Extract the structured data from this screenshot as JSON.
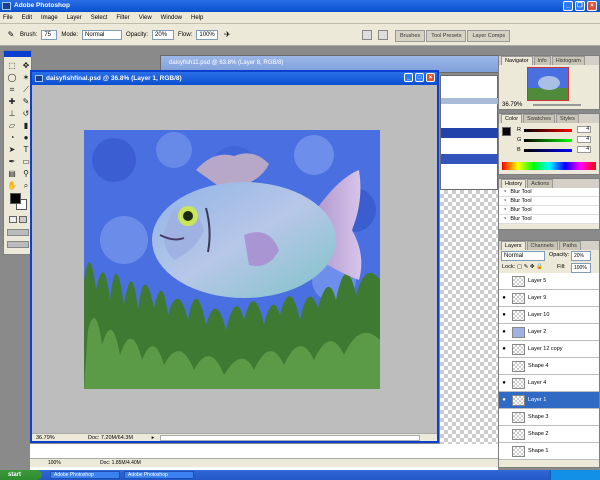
{
  "app": {
    "title": "Adobe Photoshop"
  },
  "menu": [
    "File",
    "Edit",
    "Image",
    "Layer",
    "Select",
    "Filter",
    "View",
    "Window",
    "Help"
  ],
  "options": {
    "brush_label": "Brush:",
    "brush_size": "75",
    "mode_label": "Mode:",
    "mode_value": "Normal",
    "opacity_label": "Opacity:",
    "opacity_value": "20%",
    "flow_label": "Flow:",
    "flow_value": "100%"
  },
  "palette_well": [
    "Brushes",
    "Tool Presets",
    "Layer Comps"
  ],
  "document": {
    "title": "daisyfishfinal.psd @ 36.8% (Layer 1, RGB/8)",
    "zoom": "36.79%",
    "doc_info": "Doc: 7.20M/64.3M"
  },
  "bg_document": {
    "title": "daisyfish11.psd @ 63.8% (Layer 8, RGB/8)",
    "zoom": "100%",
    "doc_info": "Doc: 1.85M/4.40M"
  },
  "navigator": {
    "tabs": [
      "Navigator",
      "Info",
      "Histogram"
    ],
    "zoom": "36.79%"
  },
  "color_panel": {
    "tabs": [
      "Color",
      "Swatches",
      "Styles"
    ],
    "r": "4",
    "g": "4",
    "b": "4",
    "colors": {
      "fg": "#050505",
      "bg": "#ffffff"
    }
  },
  "history": {
    "tabs": [
      "History",
      "Actions"
    ],
    "items": [
      "Blur Tool",
      "Blur Tool",
      "Blur Tool",
      "Blur Tool"
    ]
  },
  "layers": {
    "tabs": [
      "Layers",
      "Channels",
      "Paths"
    ],
    "blend_mode": "Normal",
    "opacity_label": "Opacity:",
    "opacity_value": "20%",
    "lock_label": "Lock:",
    "fill_label": "Fill:",
    "fill_value": "100%",
    "items": [
      {
        "name": "Layer 5",
        "visible": false,
        "selected": false
      },
      {
        "name": "Layer 9",
        "visible": true,
        "selected": false
      },
      {
        "name": "Layer 10",
        "visible": true,
        "selected": false
      },
      {
        "name": "Layer 2",
        "visible": true,
        "selected": false
      },
      {
        "name": "Layer 12 copy",
        "visible": true,
        "selected": false
      },
      {
        "name": "Shape 4",
        "visible": false,
        "selected": false
      },
      {
        "name": "Layer 4",
        "visible": true,
        "selected": false
      },
      {
        "name": "Layer 1",
        "visible": true,
        "selected": true
      },
      {
        "name": "Shape 3",
        "visible": false,
        "selected": false
      },
      {
        "name": "Shape 2",
        "visible": false,
        "selected": false
      },
      {
        "name": "Shape 1",
        "visible": false,
        "selected": false
      }
    ]
  },
  "taskbar": {
    "start_label": "start",
    "tasks": [
      "Adobe Photoshop",
      "Adobe Photoshop"
    ]
  }
}
